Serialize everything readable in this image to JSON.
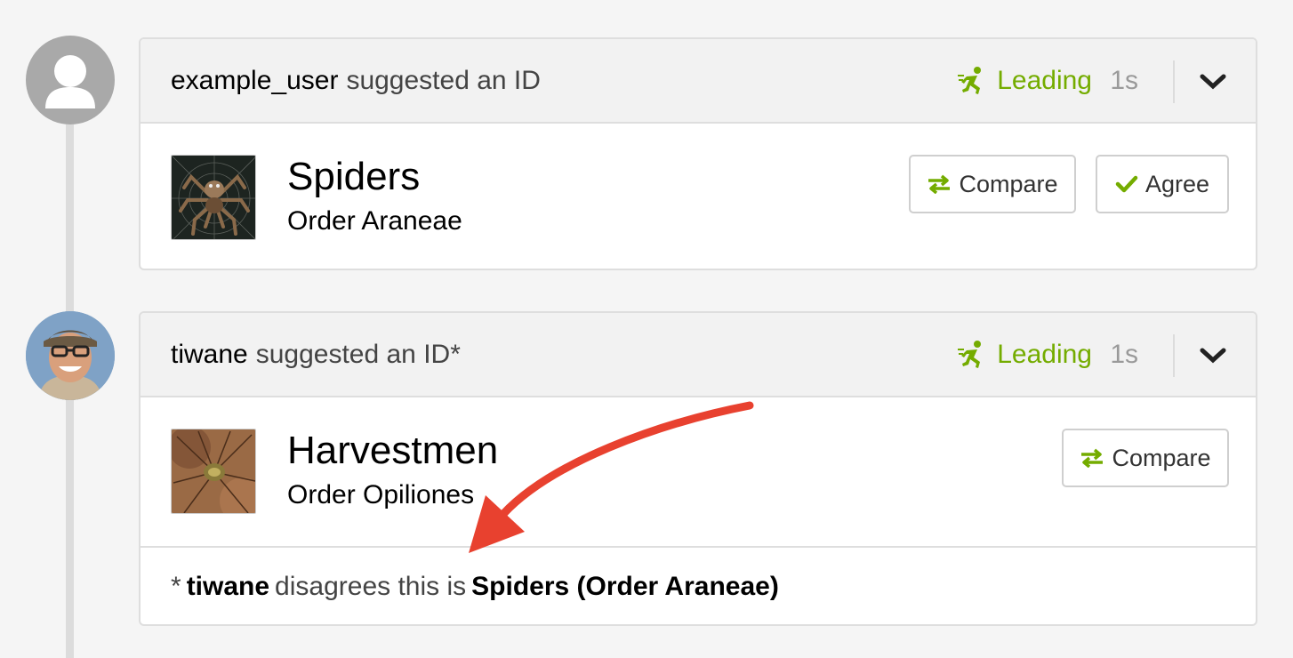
{
  "colors": {
    "accent_green": "#74ac00",
    "arrow_red": "#e8412f"
  },
  "identifications": [
    {
      "user": "example_user",
      "action": "suggested an ID",
      "status": "Leading",
      "time": "1s",
      "taxon_name": "Spiders",
      "taxon_rank": "Order Araneae",
      "buttons": {
        "compare": "Compare",
        "agree": "Agree"
      }
    },
    {
      "user": "tiwane",
      "action": "suggested an ID*",
      "status": "Leading",
      "time": "1s",
      "taxon_name": "Harvestmen",
      "taxon_rank": "Order Opiliones",
      "buttons": {
        "compare": "Compare"
      },
      "disagreement": {
        "prefix": "*",
        "user": "tiwane",
        "text": "disagrees this is",
        "taxon": "Spiders (Order Araneae)"
      }
    }
  ],
  "icons": [
    "user-silhouette-icon",
    "running-icon",
    "chevron-down-icon",
    "compare-arrows-icon",
    "check-icon",
    "annotation-arrow-icon"
  ]
}
